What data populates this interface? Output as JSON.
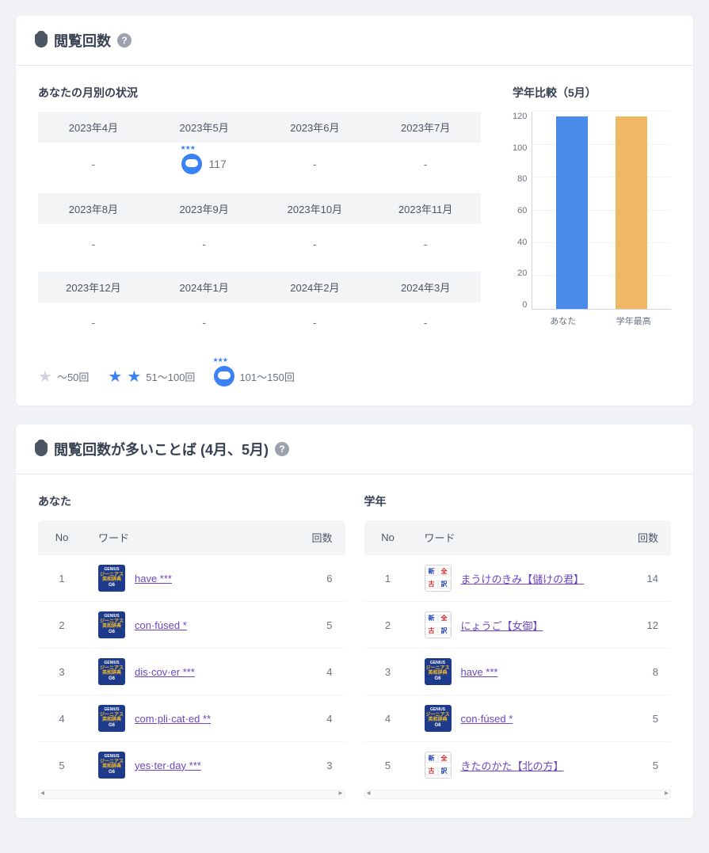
{
  "card1": {
    "title": "閲覧回数",
    "monthly_title": "あなたの月別の状況",
    "months": [
      {
        "label": "2023年4月",
        "value": "-"
      },
      {
        "label": "2023年5月",
        "value": "117",
        "has_mascot": true
      },
      {
        "label": "2023年6月",
        "value": "-"
      },
      {
        "label": "2023年7月",
        "value": "-"
      },
      {
        "label": "2023年8月",
        "value": "-"
      },
      {
        "label": "2023年9月",
        "value": "-"
      },
      {
        "label": "2023年10月",
        "value": "-"
      },
      {
        "label": "2023年11月",
        "value": "-"
      },
      {
        "label": "2023年12月",
        "value": "-"
      },
      {
        "label": "2024年1月",
        "value": "-"
      },
      {
        "label": "2024年2月",
        "value": "-"
      },
      {
        "label": "2024年3月",
        "value": "-"
      }
    ],
    "legend": [
      {
        "icon": "star1",
        "label": "～50回"
      },
      {
        "icon": "star2",
        "label": "51～100回"
      },
      {
        "icon": "mascot",
        "label": "101～150回"
      }
    ],
    "chart_title": "学年比較（5月）"
  },
  "chart_data": {
    "type": "bar",
    "title": "学年比較（5月）",
    "categories": [
      "あなた",
      "学年最高"
    ],
    "values": [
      117,
      117
    ],
    "ylim": [
      0,
      120
    ],
    "yticks": [
      0,
      20,
      40,
      60,
      80,
      100,
      120
    ],
    "colors": [
      "#4a8ae8",
      "#f0b765"
    ]
  },
  "card2": {
    "title": "閲覧回数が多いことば (4月、5月)",
    "you_title": "あなた",
    "grade_title": "学年",
    "columns": {
      "no": "No",
      "word": "ワード",
      "count": "回数"
    },
    "you_rows": [
      {
        "no": 1,
        "dict": "g6",
        "word": "have ***",
        "count": 6
      },
      {
        "no": 2,
        "dict": "g6",
        "word": "con·fúsed *",
        "count": 5
      },
      {
        "no": 3,
        "dict": "g6",
        "word": "dis·cov·er ***",
        "count": 4
      },
      {
        "no": 4,
        "dict": "g6",
        "word": "com·pli·cat·ed **",
        "count": 4
      },
      {
        "no": 5,
        "dict": "g6",
        "word": "yes·ter·day ***",
        "count": 3
      }
    ],
    "grade_rows": [
      {
        "no": 1,
        "dict": "kogo",
        "word": "まうけのきみ【儲けの君】",
        "count": 14
      },
      {
        "no": 2,
        "dict": "kogo",
        "word": "にょうご【女御】",
        "count": 12
      },
      {
        "no": 3,
        "dict": "g6",
        "word": "have ***",
        "count": 8
      },
      {
        "no": 4,
        "dict": "g6",
        "word": "con·fúsed *",
        "count": 5
      },
      {
        "no": 5,
        "dict": "kogo",
        "word": "きたのかた【北の方】",
        "count": 5
      }
    ]
  }
}
